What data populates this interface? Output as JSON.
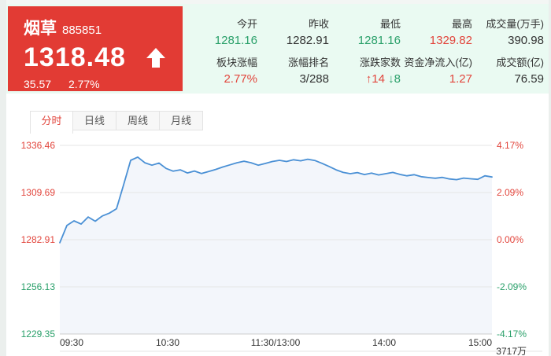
{
  "quote": {
    "name": "烟草",
    "code": "885851",
    "price": "1318.48",
    "change": "35.57",
    "change_pct": "2.77%"
  },
  "stats": {
    "row1": [
      {
        "label": "今开",
        "value": "1281.16",
        "color": "#2aa06a"
      },
      {
        "label": "昨收",
        "value": "1282.91",
        "color": "#333333"
      },
      {
        "label": "最低",
        "value": "1281.16",
        "color": "#2aa06a"
      },
      {
        "label": "最高",
        "value": "1329.82",
        "color": "#e2453c"
      },
      {
        "label": "成交量(万手)",
        "value": "390.98",
        "color": "#333333"
      }
    ],
    "row2": [
      {
        "label": "板块涨幅",
        "value": "2.77%",
        "color": "#e2453c"
      },
      {
        "label": "涨幅排名",
        "value": "3/288",
        "color": "#333333"
      },
      {
        "label": "涨跌家数",
        "up_arrow": "↑",
        "up": "14",
        "down_arrow": "↓",
        "down": "8"
      },
      {
        "label": "资金净流入(亿)",
        "value": "1.27",
        "color": "#e2453c"
      },
      {
        "label": "成交额(亿)",
        "value": "76.59",
        "color": "#333333"
      }
    ]
  },
  "tabs": [
    {
      "label": "分时",
      "active": true
    },
    {
      "label": "日线",
      "active": false
    },
    {
      "label": "周线",
      "active": false
    },
    {
      "label": "月线",
      "active": false
    }
  ],
  "chart_data": {
    "type": "line",
    "subtype": "intraday-area",
    "title": "",
    "xlabel": "",
    "ylabel": "",
    "x_ticks": [
      "09:30",
      "10:30",
      "11:30/13:00",
      "14:00",
      "15:00"
    ],
    "y_axis_left": [
      {
        "label": "1336.46",
        "color": "#e2453c"
      },
      {
        "label": "1309.69",
        "color": "#e2453c"
      },
      {
        "label": "1282.91",
        "color": "#e2453c"
      },
      {
        "label": "1256.13",
        "color": "#2aa06a"
      },
      {
        "label": "1229.35",
        "color": "#2aa06a"
      }
    ],
    "y_axis_right": [
      {
        "label": "4.17%",
        "color": "#e2453c"
      },
      {
        "label": "2.09%",
        "color": "#e2453c"
      },
      {
        "label": "0.00%",
        "color": "#e2453c"
      },
      {
        "label": "-2.09%",
        "color": "#2aa06a"
      },
      {
        "label": "-4.17%",
        "color": "#2aa06a"
      }
    ],
    "ylim": [
      1229.35,
      1336.46
    ],
    "baseline_prev_close": 1282.91,
    "open": 1281.16,
    "high": 1329.82,
    "low": 1281.16,
    "close": 1318.48,
    "grid": true,
    "legend_position": "none",
    "volume_axis_label": "3717万",
    "line_color": "#4a90d5",
    "fill_color": "#f3f6fb",
    "series": [
      1281.2,
      1291.0,
      1293.6,
      1291.8,
      1295.8,
      1293.4,
      1296.4,
      1298.0,
      1300.5,
      1314.0,
      1328.0,
      1329.8,
      1326.6,
      1325.2,
      1326.4,
      1323.4,
      1321.8,
      1322.6,
      1320.8,
      1321.9,
      1320.5,
      1321.6,
      1322.8,
      1324.2,
      1325.4,
      1326.6,
      1327.5,
      1326.6,
      1325.2,
      1326.2,
      1327.3,
      1328.0,
      1327.3,
      1328.3,
      1327.7,
      1328.6,
      1327.9,
      1326.3,
      1324.5,
      1322.6,
      1321.1,
      1320.4,
      1321.0,
      1319.9,
      1320.7,
      1319.7,
      1320.4,
      1321.1,
      1320.0,
      1319.2,
      1319.8,
      1318.7,
      1318.2,
      1317.8,
      1318.3,
      1317.4,
      1317.0,
      1317.9,
      1317.5,
      1317.2,
      1319.2,
      1318.5
    ]
  }
}
